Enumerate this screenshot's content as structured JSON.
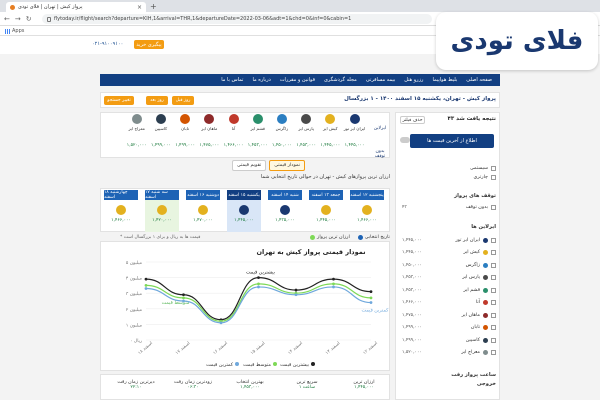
{
  "browser": {
    "tab_title": "پرواز کیش | تهران | فلای تودی",
    "new_tab": "+",
    "url": "flytoday.ir/flight/search?departure=KIH,1&arrival=THR,1&departureDate=2022-03-06&adt=1&chd=0&inf=0&cabin=1",
    "apps_label": "Apps"
  },
  "header": {
    "signup_label": "پیگیری خرید",
    "phone": "۰۲۱-۹۱۰۰۹۱۰۰",
    "logo_text": "فلای تودی"
  },
  "nav": {
    "items": [
      "صفحه اصلی",
      "بلیط هواپیما",
      "رزرو هتل",
      "بیمه مسافرتی",
      "مجله گردشگری",
      "قوانین و مقررات",
      "درباره ما",
      "تماس با ما"
    ]
  },
  "search_bar": {
    "route": "پرواز کیش - تهران، یکشنبه ۱۵ اسفند ۱۴۰۰ - ۱ بزرگسال",
    "prev_day": "روز قبل",
    "next_day": "روز بعد",
    "change_search": "تغییر جستجو"
  },
  "sidebar": {
    "title": "۴۳ نتیجه یافت شد",
    "clear_filters": "حذف فیلتر",
    "alert_label": "اطلاع از آخرین قیمت ها",
    "flight_types": [
      "سیستمی",
      "چارتری"
    ],
    "stops_title": "توقف های پرواز",
    "stops": [
      {
        "label": "بدون توقف",
        "count": "۴۳"
      }
    ],
    "airlines_title": "ایرلاین ها",
    "airlines": [
      {
        "name": "ایران ایر تور",
        "price": "۱,۴۴۵,۰۰۰",
        "color": "#1a3870"
      },
      {
        "name": "کیش ایر",
        "price": "۱,۴۴۵,۰۰۰",
        "color": "#e3b11f"
      },
      {
        "name": "زاگرس",
        "price": "۱,۴۵۰,۰۰۰",
        "color": "#2b7ec1"
      },
      {
        "name": "پارس ایر",
        "price": "۱,۴۵۳,۰۰۰",
        "color": "#4a4a4a"
      },
      {
        "name": "قشم ایر",
        "price": "۱,۴۵۳,۰۰۰",
        "color": "#2a8f6b"
      },
      {
        "name": "آتا",
        "price": "۱,۴۶۶,۰۰۰",
        "color": "#c0392b"
      },
      {
        "name": "ماهان ایر",
        "price": "۱,۴۷۵,۰۰۰",
        "color": "#8e2a2a"
      },
      {
        "name": "تابان",
        "price": "۱,۴۹۹,۰۰۰",
        "color": "#d35400"
      },
      {
        "name": "کاسپین",
        "price": "۱,۴۹۹,۰۰۰",
        "color": "#2c3e50"
      },
      {
        "name": "معراج ایر",
        "price": "۱,۵۲۰,۰۰۰",
        "color": "#7f8c8d"
      }
    ],
    "times_title": "ساعت پرواز رفت",
    "times_sub": "خروجی"
  },
  "airline_panel": {
    "label_airline": "ایرلاین",
    "label_nonstop": "بدون توقف",
    "cells": [
      {
        "name": "ایران ایر تور",
        "price": "۱,۴۴۵,۰۰۰",
        "color": "#1a3870"
      },
      {
        "name": "کیش ایر",
        "price": "۱,۴۴۵,۰۰۰",
        "color": "#e3b11f"
      },
      {
        "name": "پارس ایر",
        "price": "۱,۴۵۳,۰۰۰",
        "color": "#4a4a4a"
      },
      {
        "name": "زاگرس",
        "price": "۱,۴۵۰,۰۰۰",
        "color": "#2b7ec1"
      },
      {
        "name": "قشم ایر",
        "price": "۱,۴۵۳,۰۰۰",
        "color": "#2a8f6b"
      },
      {
        "name": "آتا",
        "price": "۱,۴۶۶,۰۰۰",
        "color": "#c0392b"
      },
      {
        "name": "ماهان ایر",
        "price": "۱,۴۷۵,۰۰۰",
        "color": "#8e2a2a"
      },
      {
        "name": "تابان",
        "price": "۱,۴۹۹,۰۰۰",
        "color": "#d35400"
      },
      {
        "name": "کاسپین",
        "price": "۱,۴۹۹,۰۰۰",
        "color": "#2c3e50"
      },
      {
        "name": "معراج ایر",
        "price": "۱,۵۲۰,۰۰۰",
        "color": "#7f8c8d"
      }
    ]
  },
  "view_tabs": {
    "calendar": "تقویم قیمتی",
    "chart": "نمودار قیمتی"
  },
  "calendar": {
    "title": "ارزان ترین پروازهای کیش - تهران در حوالی تاریخ انتخابی شما",
    "note": "* قیمت ها به ریال و برای ۱ بزرگسال است",
    "days": [
      {
        "label": "پنجشنبه ۱۲ اسفند",
        "price": "۱,۴۶۶,۰۰۰",
        "color": "#e3b11f",
        "state": ""
      },
      {
        "label": "جمعه ۱۳ اسفند",
        "price": "۱,۴۴۵,۰۰۰",
        "color": "#e3b11f",
        "state": ""
      },
      {
        "label": "شنبه ۱۴ اسفند",
        "price": "۱,۴۳۵,۰۰۰",
        "color": "#1a3870",
        "state": ""
      },
      {
        "label": "یکشنبه ۱۵ اسفند",
        "price": "۱,۴۴۵,۰۰۰",
        "color": "#1a3870",
        "state": "sel"
      },
      {
        "label": "دوشنبه ۱۶ اسفند",
        "price": "۱,۴۷۰,۰۰۰",
        "color": "#e3b11f",
        "state": ""
      },
      {
        "label": "سه شنبه ۱۷ اسفند",
        "price": "۱,۴۲۰,۰۰۰",
        "color": "#e3b11f",
        "state": "grn"
      },
      {
        "label": "چهارشنبه ۱۸ اسفند",
        "price": "۱,۴۶۶,۰۰۰",
        "color": "#e3b11f",
        "state": ""
      }
    ]
  },
  "chart_legend_top": {
    "date": "تاریخ انتخابی",
    "cheapest": "ارزان ترین پرواز"
  },
  "chart_data": {
    "type": "line",
    "title": "نمودار قیمتی پرواز کیش به تهران",
    "categories": [
      "۱۲ اسفند",
      "۱۳ اسفند",
      "۱۴ اسفند",
      "۱۵ اسفند",
      "۱۶ اسفند",
      "۱۷ اسفند",
      "۱۸ اسفند"
    ],
    "ylabel": "",
    "y_tick_labels": [
      "۰ ریال",
      "۱ میلیون",
      "۲ میلیون",
      "۳ میلیون",
      "۴ میلیون",
      "۵ میلیون"
    ],
    "ylim": [
      0,
      5
    ],
    "series": [
      {
        "name": "بیشترین قیمت",
        "color": "#222222",
        "values": [
          3.1,
          3.9,
          3.2,
          4.0,
          1.3,
          2.9,
          3.9
        ]
      },
      {
        "name": "متوسط قیمت",
        "color": "#7ed957",
        "values": [
          2.7,
          3.6,
          3.0,
          3.6,
          1.2,
          2.7,
          3.5
        ]
      },
      {
        "name": "کمترین قیمت",
        "color": "#6fa8dc",
        "values": [
          2.4,
          3.4,
          2.9,
          3.4,
          1.1,
          2.5,
          3.3
        ]
      }
    ],
    "annotations": {
      "max_label": "بیشترین قیمت",
      "min_label": "کمترین قیمت",
      "avg_label": "متوسط قیمت"
    },
    "legend": "bottom"
  },
  "bottom_summary": [
    {
      "title": "ارزان ترین",
      "sub": "۱,۴۴۵,۰۰۰"
    },
    {
      "title": "سریع ترین",
      "sub": "۱ ساعت"
    },
    {
      "title": "بهترین انتخاب",
      "sub": "۱,۴۵۳,۰۰۰"
    },
    {
      "title": "زودترین زمان رفت",
      "sub": "۰۶:۳۰"
    },
    {
      "title": "دیرترین زمان رفت",
      "sub": "۲۲:۱۰"
    }
  ]
}
